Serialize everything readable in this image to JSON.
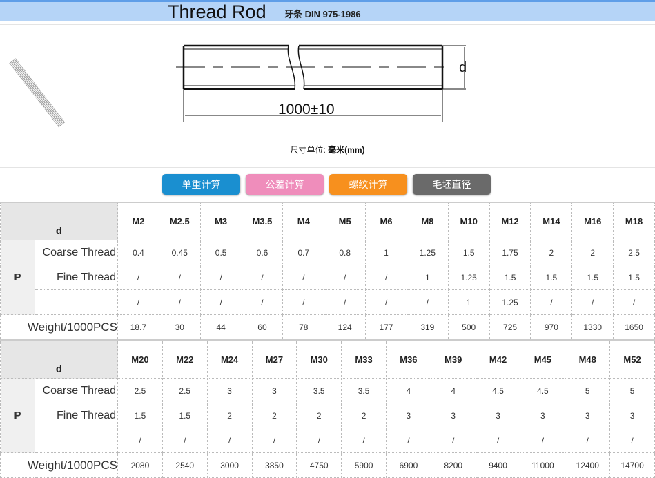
{
  "header": {
    "title": "Thread Rod",
    "subtitle": "牙条 DIN 975-1986"
  },
  "drawing": {
    "dimension_d": "d",
    "length": "1000±10",
    "unit_label": "尺寸单位: ",
    "unit_value": "毫米(mm)"
  },
  "buttons": [
    {
      "label": "单重计算",
      "color": "#1a8fd0"
    },
    {
      "label": "公差计算",
      "color": "#ef8dbb"
    },
    {
      "label": "螺纹计算",
      "color": "#f7901e"
    },
    {
      "label": "毛坯直径",
      "color": "#6a6a6a"
    }
  ],
  "labels": {
    "d": "d",
    "p": "P",
    "coarse": "Coarse Thread",
    "fine": "Fine Thread",
    "extra": "",
    "weight": "Weight/1000PCS"
  },
  "tables": [
    {
      "sizes": [
        "M2",
        "M2.5",
        "M3",
        "M3.5",
        "M4",
        "M5",
        "M6",
        "M8",
        "M10",
        "M12",
        "M14",
        "M16",
        "M18"
      ],
      "coarse": [
        "0.4",
        "0.45",
        "0.5",
        "0.6",
        "0.7",
        "0.8",
        "1",
        "1.25",
        "1.5",
        "1.75",
        "2",
        "2",
        "2.5"
      ],
      "fine": [
        "/",
        "/",
        "/",
        "/",
        "/",
        "/",
        "/",
        "1",
        "1.25",
        "1.5",
        "1.5",
        "1.5",
        "1.5"
      ],
      "fine2": [
        "/",
        "/",
        "/",
        "/",
        "/",
        "/",
        "/",
        "/",
        "1",
        "1.25",
        "/",
        "/",
        "/"
      ],
      "weight": [
        "18.7",
        "30",
        "44",
        "60",
        "78",
        "124",
        "177",
        "319",
        "500",
        "725",
        "970",
        "1330",
        "1650"
      ]
    },
    {
      "sizes": [
        "M20",
        "M22",
        "M24",
        "M27",
        "M30",
        "M33",
        "M36",
        "M39",
        "M42",
        "M45",
        "M48",
        "M52"
      ],
      "coarse": [
        "2.5",
        "2.5",
        "3",
        "3",
        "3.5",
        "3.5",
        "4",
        "4",
        "4.5",
        "4.5",
        "5",
        "5"
      ],
      "fine": [
        "1.5",
        "1.5",
        "2",
        "2",
        "2",
        "2",
        "3",
        "3",
        "3",
        "3",
        "3",
        "3"
      ],
      "fine2": [
        "/",
        "/",
        "/",
        "/",
        "/",
        "/",
        "/",
        "/",
        "/",
        "/",
        "/",
        "/"
      ],
      "weight": [
        "2080",
        "2540",
        "3000",
        "3850",
        "4750",
        "5900",
        "6900",
        "8200",
        "9400",
        "11000",
        "12400",
        "14700"
      ]
    }
  ]
}
